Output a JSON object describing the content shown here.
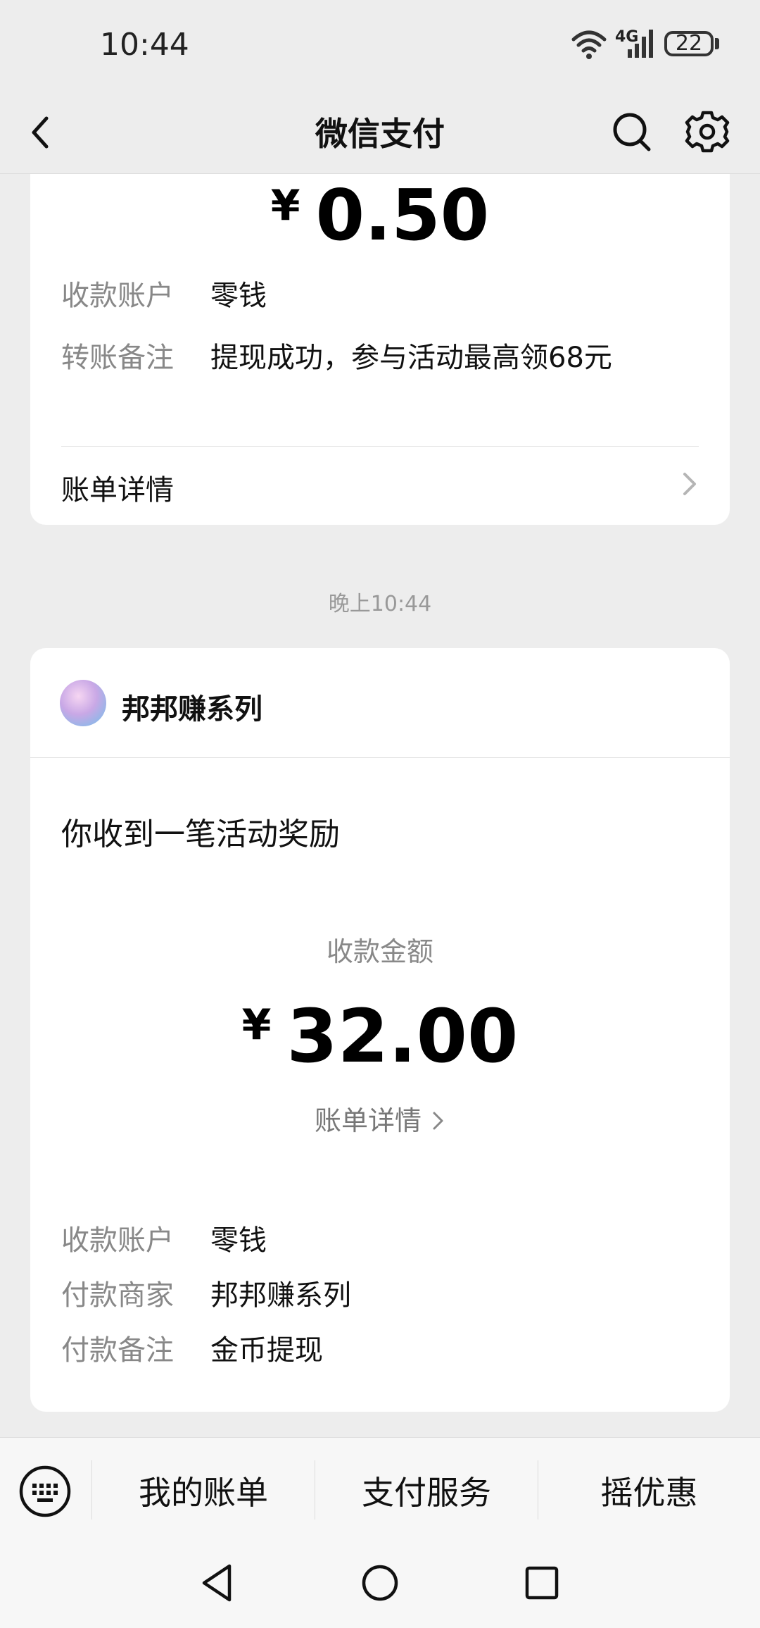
{
  "status_bar": {
    "time": "10:44",
    "network": "4G",
    "battery": "22"
  },
  "nav": {
    "title": "微信支付",
    "icons": [
      "back-icon",
      "search-icon",
      "gear-icon"
    ]
  },
  "card1": {
    "currency": "¥",
    "amount": "0.50",
    "rows": [
      {
        "label": "收款账户",
        "value": "零钱"
      },
      {
        "label": "转账备注",
        "value": "提现成功，参与活动最高领68元"
      }
    ],
    "bill_detail": "账单详情"
  },
  "timestamp": "晚上10:44",
  "card2": {
    "merchant": "邦邦赚系列",
    "headline": "你收到一笔活动奖励",
    "amount_label": "收款金额",
    "currency": "¥",
    "amount": "32.00",
    "bill_detail": "账单详情",
    "rows": [
      {
        "label": "收款账户",
        "value": "零钱"
      },
      {
        "label": "付款商家",
        "value": "邦邦赚系列"
      },
      {
        "label": "付款备注",
        "value": "金币提现"
      }
    ]
  },
  "bottom_menu": {
    "items": [
      "我的账单",
      "支付服务",
      "摇优惠"
    ]
  }
}
